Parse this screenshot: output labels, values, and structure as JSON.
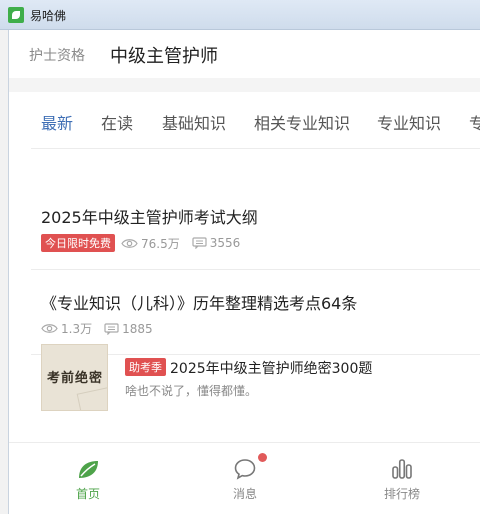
{
  "window": {
    "title": "易哈佛"
  },
  "header": {
    "breadcrumb": "护士资格",
    "title": "中级主管护师"
  },
  "tabs": [
    {
      "label": "最新",
      "active": true
    },
    {
      "label": "在读",
      "active": false
    },
    {
      "label": "基础知识",
      "active": false
    },
    {
      "label": "相关专业知识",
      "active": false
    },
    {
      "label": "专业知识",
      "active": false
    },
    {
      "label": "专",
      "active": false
    }
  ],
  "items": [
    {
      "title": "2025年中级主管护师考试大纲",
      "badge": "今日限时免费",
      "views": "76.5万",
      "comments": "3556"
    },
    {
      "title": "《专业知识（儿科）》历年整理精选考点64条",
      "views": "1.3万",
      "comments": "1885"
    }
  ],
  "promo": {
    "thumb_text": "考前绝密",
    "badge": "助考季",
    "title": "2025年中级主管护师绝密300题",
    "subtitle": "啥也不说了，懂得都懂。"
  },
  "bottom_nav": [
    {
      "label": "首页",
      "icon": "leaf-icon",
      "active": true
    },
    {
      "label": "消息",
      "icon": "chat-bubble-icon",
      "active": false,
      "has_dot": true
    },
    {
      "label": "排行榜",
      "icon": "bar-chart-icon",
      "active": false
    }
  ],
  "colors": {
    "accent": "#3f6fb5",
    "badge": "#e05151",
    "nav_active": "#4ea34a"
  }
}
